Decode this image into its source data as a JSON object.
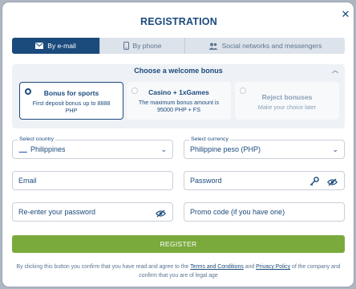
{
  "dialog": {
    "title": "REGISTRATION",
    "close_icon": "close-icon"
  },
  "tabs": [
    {
      "label": "By e-mail",
      "icon": "envelope-icon",
      "active": true
    },
    {
      "label": "By phone",
      "icon": "phone-icon",
      "active": false
    },
    {
      "label": "Social networks and messengers",
      "icon": "people-icon",
      "active": false
    }
  ],
  "bonus": {
    "heading": "Choose a welcome bonus",
    "options": [
      {
        "title": "Bonus for sports",
        "desc": "First deposit bonus up to 8888 PHP",
        "selected": true
      },
      {
        "title": "Casino + 1xGames",
        "desc": "The maximum bonus amount is 95000 PHP + FS",
        "selected": false
      },
      {
        "title": "Reject bonuses",
        "desc": "Make your choice later",
        "selected": false
      }
    ]
  },
  "form": {
    "country": {
      "label": "Select country",
      "value": "Philippines"
    },
    "currency": {
      "label": "Select currency",
      "value": "Philippine peso (PHP)"
    },
    "email": {
      "placeholder": "Email"
    },
    "password": {
      "placeholder": "Password"
    },
    "repassword": {
      "placeholder": "Re-enter your password"
    },
    "promo": {
      "placeholder": "Promo code (if you have one)"
    }
  },
  "register_label": "REGISTER",
  "legal": {
    "prefix": "By clicking this button you confirm that you have read and agree to the",
    "terms": "Terms and Conditions",
    "and": "and",
    "privacy": "Privacy Policy",
    "suffix": "of the company and confirm that you are of legal age"
  },
  "colors": {
    "brand": "#1b4a7c",
    "register": "#7aaa3c",
    "overlay": "#aeb6c2"
  }
}
